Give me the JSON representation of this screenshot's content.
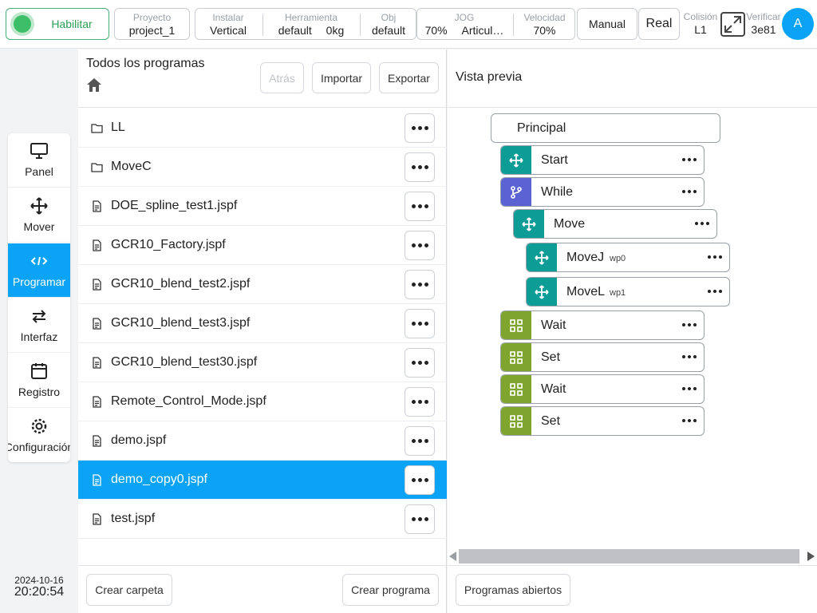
{
  "topbar": {
    "enable_label": "Habilitar",
    "project_label": "Proyecto",
    "project_value": "project_1",
    "install_label": "Instalar",
    "install_value": "Vertical",
    "tool_label": "Herramienta",
    "tool_value": "default",
    "tool_load": "0kg",
    "obj_label": "Obj",
    "obj_value": "default",
    "jog_label": "JOG",
    "jog_value": "70%",
    "jog_mode": "Articul…",
    "speed_label": "Velocidad",
    "speed_value": "70%",
    "manual_label": "Manual",
    "real_label": "Real",
    "collision_label": "Colisión",
    "collision_value": "L1",
    "verify_label": "Verificar",
    "verify_value": "3e81",
    "avatar_letter": "A"
  },
  "nav": {
    "items": [
      {
        "label": "Panel",
        "icon": "monitor-icon"
      },
      {
        "label": "Mover",
        "icon": "move-icon"
      },
      {
        "label": "Programar",
        "icon": "code-icon"
      },
      {
        "label": "Interfaz",
        "icon": "swap-icon"
      },
      {
        "label": "Registro",
        "icon": "calendar-icon"
      },
      {
        "label": "Configuración",
        "icon": "gear-icon"
      }
    ],
    "active_index": 2
  },
  "clock": {
    "date": "2024-10-16",
    "time": "20:20:54"
  },
  "files": {
    "title": "Todos los programas",
    "back_label": "Atrás",
    "import_label": "Importar",
    "export_label": "Exportar",
    "rows": [
      {
        "name": "LL",
        "type": "folder"
      },
      {
        "name": "MoveC",
        "type": "folder"
      },
      {
        "name": "DOE_spline_test1.jspf",
        "type": "file"
      },
      {
        "name": "GCR10_Factory.jspf",
        "type": "file"
      },
      {
        "name": "GCR10_blend_test2.jspf",
        "type": "file"
      },
      {
        "name": "GCR10_blend_test3.jspf",
        "type": "file"
      },
      {
        "name": "GCR10_blend_test30.jspf",
        "type": "file"
      },
      {
        "name": "Remote_Control_Mode.jspf",
        "type": "file"
      },
      {
        "name": "demo.jspf",
        "type": "file"
      },
      {
        "name": "demo_copy0.jspf",
        "type": "file"
      },
      {
        "name": "test.jspf",
        "type": "file"
      }
    ],
    "selected_index": 9,
    "create_folder_label": "Crear carpeta",
    "create_program_label": "Crear programa"
  },
  "preview": {
    "title": "Vista previa",
    "root": "Principal",
    "nodes": [
      {
        "label": "Start",
        "sub": "",
        "kind": "move"
      },
      {
        "label": "While",
        "sub": "",
        "kind": "branch"
      },
      {
        "label": "Move",
        "sub": "",
        "kind": "move"
      },
      {
        "label": "MoveJ",
        "sub": "wp0",
        "kind": "move"
      },
      {
        "label": "MoveL",
        "sub": "wp1",
        "kind": "move"
      },
      {
        "label": "Wait",
        "sub": "",
        "kind": "grid"
      },
      {
        "label": "Set",
        "sub": "",
        "kind": "grid"
      },
      {
        "label": "Wait",
        "sub": "",
        "kind": "grid"
      },
      {
        "label": "Set",
        "sub": "",
        "kind": "grid"
      }
    ],
    "open_programs_label": "Programas abiertos"
  },
  "colors": {
    "accent": "#0aa3f5",
    "enable_green": "#3dbf6a",
    "move_teal": "#0e9c97",
    "branch_purple": "#5b63d3",
    "grid_olive": "#7fa52f"
  }
}
